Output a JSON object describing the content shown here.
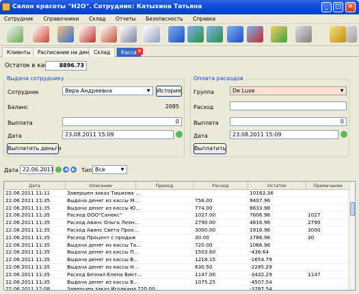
{
  "window": {
    "title": "Салон красоты \"H2O\". Сотрудник: Катыхина Татьяна"
  },
  "menu": [
    "Сотрудник",
    "Справочники",
    "Склад",
    "Отчеты",
    "Безопасность",
    "Справка"
  ],
  "toolbar_icons": [
    "edit-icon",
    "document-edit-icon",
    "users-icon",
    "report-icon",
    "calendar-icon",
    "mail-icon",
    "box-icon",
    "box-add-icon",
    "box-remove-icon",
    "box-move-icon",
    "box-list-icon",
    "keys-icon",
    "settings-icon",
    "lock-icon",
    "exit-icon"
  ],
  "tabs": [
    "Клиенты",
    "Расписание на день",
    "Склад",
    "Касса"
  ],
  "balance": {
    "label": "Остаток в кассе",
    "value": "8896.73"
  },
  "payout": {
    "title": "Выдача сотруднику",
    "employee_label": "Сотрудник",
    "employee_value": "Вера Андреевна",
    "history_button": "История",
    "balance_label": "Баланс",
    "balance_value": "2085",
    "payment_label": "Выплата",
    "payment_value": "0",
    "date_label": "Дата",
    "date_value": "23.08.2011 15:09",
    "pay_button": "Выплатить деньги"
  },
  "expenses": {
    "title": "Оплата расходов",
    "group_label": "Группа",
    "group_value": "De Luxe",
    "expense_label": "Расход",
    "expense_value": "",
    "payment_label": "Выплата",
    "payment_value": "0",
    "date_label": "Дата",
    "date_value": "23.08.2011 15:09",
    "pay_button": "Выплатить"
  },
  "filter": {
    "date_label": "Дата",
    "date_value": "22.06.2011",
    "type_label": "Тип",
    "type_value": "Все"
  },
  "table": {
    "columns": [
      "Дата",
      "Описание",
      "Приход",
      "Расход",
      "Остаток",
      "Примечание"
    ],
    "rows": [
      [
        "22.06.2011 11:11",
        "Завершен заказ Тишкова ...",
        "",
        "",
        "10163.36",
        ""
      ],
      [
        "22.06.2011 11:35",
        "Выдача денег из кассы М...",
        "",
        "756.00",
        "9407.96",
        ""
      ],
      [
        "22.06.2011 11:35",
        "Выдача денег из кассы Ю...",
        "",
        "774.00",
        "8633.96",
        ""
      ],
      [
        "22.06.2011 11:35",
        "Расход ООО\"Санекс\"",
        "",
        "1027.00",
        "7606.96",
        "1027"
      ],
      [
        "22.06.2011 11:35",
        "Расход Аванс Ольга Леон...",
        "",
        "2790.00",
        "4816.96",
        "2790"
      ],
      [
        "22.06.2011 11:35",
        "Расход Аванс Света Прох...",
        "",
        "3000.00",
        "1816.96",
        "3000"
      ],
      [
        "22.06.2011 11:35",
        "Расход Процент с продаж",
        "",
        "30.00",
        "1786.96",
        "30"
      ],
      [
        "22.06.2011 11:35",
        "Выдача денег из кассы Та...",
        "",
        "720.00",
        "1066.96",
        ""
      ],
      [
        "22.06.2011 11:35",
        "Выдача денег из кассы П...",
        "",
        "1503.60",
        "-436.64",
        ""
      ],
      [
        "22.06.2011 11:35",
        "Выдача денег из кассы В...",
        "",
        "1218.15",
        "-1654.79",
        ""
      ],
      [
        "22.06.2011 11:35",
        "Выдача денег из кассы Н...",
        "",
        "630.50",
        "-2285.29",
        ""
      ],
      [
        "22.06.2011 11:35",
        "Расход Безнал Елена Викт...",
        "",
        "1147.00",
        "-3432.29",
        "1147"
      ],
      [
        "22.06.2011 11:35",
        "Выдача денег из кассы В...",
        "",
        "1075.25",
        "-4507.54",
        ""
      ],
      [
        "22.06.2011 12:08",
        "Завершен заказ Иголкина...",
        "720.00",
        "",
        "-3787.54",
        ""
      ]
    ]
  },
  "colors": {
    "titlebar": "#0a49d6",
    "group_title": "#0046d5",
    "active_tab": "#316ac5"
  }
}
